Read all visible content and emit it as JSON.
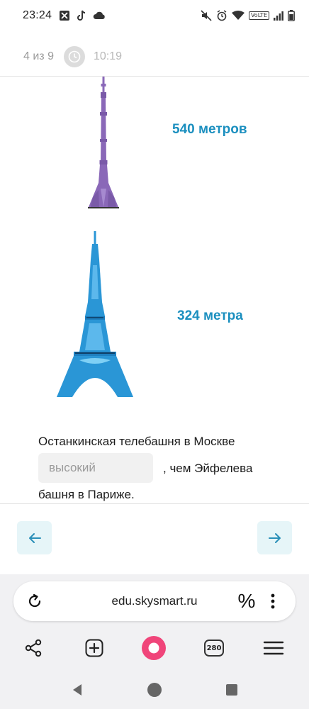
{
  "status_bar": {
    "time": "23:24",
    "left_icons": [
      "notification-icon",
      "tiktok-icon",
      "cloud-icon"
    ],
    "right_icons": [
      "mute-icon",
      "alarm-icon",
      "wifi-icon",
      "volte-icon",
      "signal-icon",
      "battery-icon"
    ],
    "volte_label": "VoLTE"
  },
  "lesson": {
    "progress": "4 из 9",
    "timer": "10:19"
  },
  "figures": [
    {
      "name": "Останкинская телебашня",
      "label": "540 метров",
      "color": "#8a68b8"
    },
    {
      "name": "Эйфелева башня",
      "label": "324 метра",
      "color": "#2a96d6"
    }
  ],
  "question": {
    "line1": "Останкинская телебашня в Москве",
    "answer_placeholder": "высокий",
    "line2_after": ", чем Эйфелева",
    "line3": "башня в Париже."
  },
  "nav": {
    "prev_icon": "arrow-left-icon",
    "next_icon": "arrow-right-icon",
    "accent": "#2a8fb8"
  },
  "browser": {
    "url": "edu.skysmart.ru",
    "percent_label": "%",
    "tab_count": "280",
    "toolbar_icons": [
      "share-icon",
      "new-tab-icon",
      "alice-icon",
      "tabs-icon",
      "menu-icon"
    ],
    "alice_color": "#f0457a"
  },
  "system_nav": [
    "back-icon",
    "home-icon",
    "recents-icon"
  ]
}
